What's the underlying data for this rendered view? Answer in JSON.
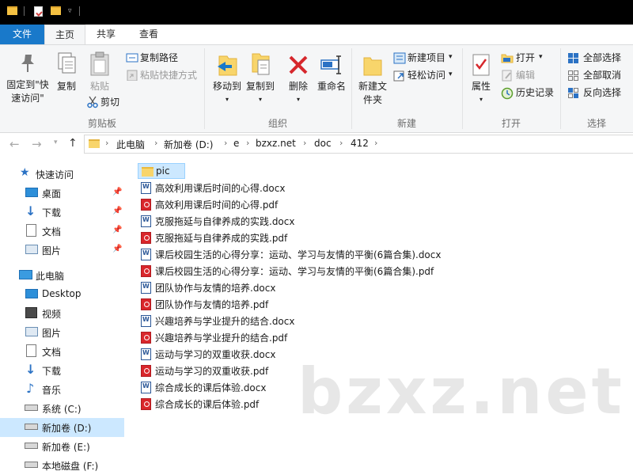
{
  "tabs": {
    "file": "文件",
    "home": "主页",
    "share": "共享",
    "view": "查看"
  },
  "ribbon": {
    "clipboard": {
      "pin": "固定到\"快速访问\"",
      "copy": "复制",
      "paste": "粘贴",
      "copy_path": "复制路径",
      "paste_shortcut": "粘贴快捷方式",
      "cut": "剪切",
      "label": "剪贴板"
    },
    "organize": {
      "move_to": "移动到",
      "copy_to": "复制到",
      "delete": "删除",
      "rename": "重命名",
      "label": "组织"
    },
    "new": {
      "new_folder": "新建文件夹",
      "new_item": "新建项目",
      "easy_access": "轻松访问",
      "label": "新建"
    },
    "open": {
      "properties": "属性",
      "open": "打开",
      "edit": "编辑",
      "history": "历史记录",
      "label": "打开"
    },
    "select": {
      "select_all": "全部选择",
      "select_none": "全部取消",
      "invert": "反向选择",
      "label": "选择"
    }
  },
  "address": {
    "crumbs": [
      "此电脑",
      "新加卷 (D:)",
      "e",
      "bzxz.net",
      "doc",
      "412"
    ]
  },
  "sidebar": {
    "quick_access": "快速访问",
    "quick_items": [
      "桌面",
      "下载",
      "文档",
      "图片"
    ],
    "this_pc": "此电脑",
    "pc_items": [
      "Desktop",
      "视频",
      "图片",
      "文档",
      "下载",
      "音乐",
      "系统 (C:)",
      "新加卷 (D:)",
      "新加卷 (E:)",
      "本地磁盘 (F:)"
    ]
  },
  "files": [
    {
      "name": "pic",
      "type": "folder"
    },
    {
      "name": "高效利用课后时间的心得.docx",
      "type": "docx"
    },
    {
      "name": "高效利用课后时间的心得.pdf",
      "type": "pdf"
    },
    {
      "name": "克服拖延与自律养成的实践.docx",
      "type": "docx"
    },
    {
      "name": "克服拖延与自律养成的实践.pdf",
      "type": "pdf"
    },
    {
      "name": "课后校园生活的心得分享：运动、学习与友情的平衡(6篇合集).docx",
      "type": "docx"
    },
    {
      "name": "课后校园生活的心得分享：运动、学习与友情的平衡(6篇合集).pdf",
      "type": "pdf"
    },
    {
      "name": "团队协作与友情的培养.docx",
      "type": "docx"
    },
    {
      "name": "团队协作与友情的培养.pdf",
      "type": "pdf"
    },
    {
      "name": "兴趣培养与学业提升的结合.docx",
      "type": "docx"
    },
    {
      "name": "兴趣培养与学业提升的结合.pdf",
      "type": "pdf"
    },
    {
      "name": "运动与学习的双重收获.docx",
      "type": "docx"
    },
    {
      "name": "运动与学习的双重收获.pdf",
      "type": "pdf"
    },
    {
      "name": "综合成长的课后体验.docx",
      "type": "docx"
    },
    {
      "name": "综合成长的课后体验.pdf",
      "type": "pdf"
    }
  ],
  "watermark": "bzxz.net",
  "colors": {
    "accent": "#1979ca",
    "selection": "#cce8ff",
    "folder": "#f8d56b",
    "pdf": "#d9262b",
    "word": "#2b5797"
  }
}
